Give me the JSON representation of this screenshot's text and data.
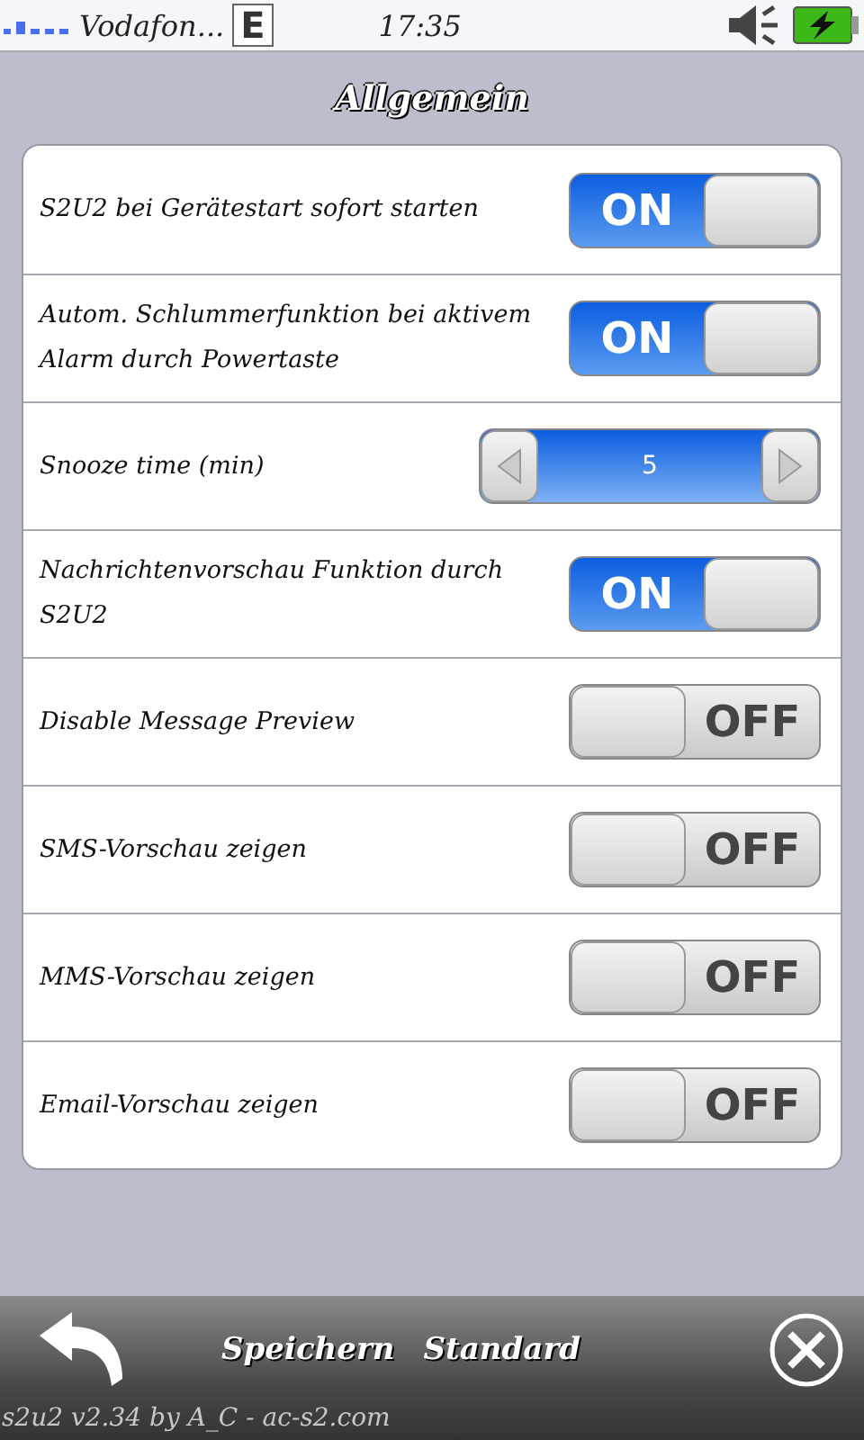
{
  "status_bar": {
    "carrier": "Vodafon...",
    "network": "E",
    "time": "17:35"
  },
  "title": "Allgemein",
  "settings": [
    {
      "kind": "toggle",
      "label": "S2U2 bei Gerätestart sofort starten",
      "on": true,
      "text": "ON"
    },
    {
      "kind": "toggle",
      "label": "Autom. Schlummerfunktion bei aktivem Alarm durch Powertaste",
      "on": true,
      "text": "ON"
    },
    {
      "kind": "stepper",
      "label": "Snooze time (min)",
      "value": "5"
    },
    {
      "kind": "toggle",
      "label": "Nachrichtenvorschau Funktion durch S2U2",
      "on": true,
      "text": "ON"
    },
    {
      "kind": "toggle",
      "label": "Disable Message Preview",
      "on": false,
      "text": "OFF"
    },
    {
      "kind": "toggle",
      "label": "SMS-Vorschau zeigen",
      "on": false,
      "text": "OFF"
    },
    {
      "kind": "toggle",
      "label": "MMS-Vorschau zeigen",
      "on": false,
      "text": "OFF"
    },
    {
      "kind": "toggle",
      "label": "Email-Vorschau zeigen",
      "on": false,
      "text": "OFF"
    }
  ],
  "bottom_bar": {
    "buttons": [
      "Speichern",
      "Standard"
    ],
    "footer": "s2u2 v2.34 by A_C - ac-s2.com"
  }
}
